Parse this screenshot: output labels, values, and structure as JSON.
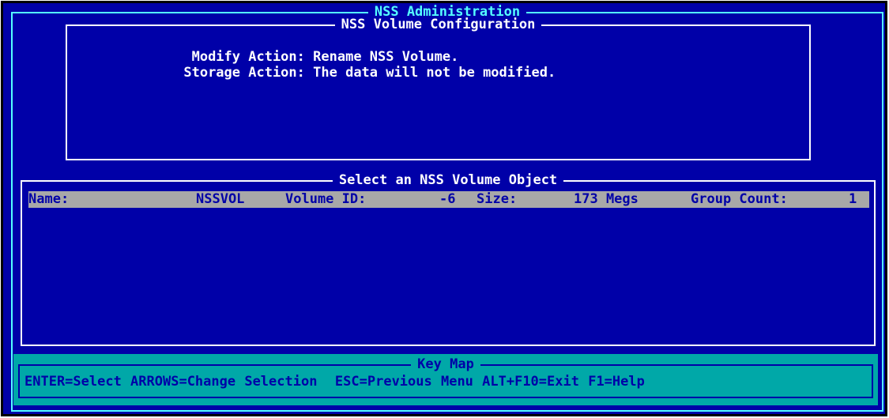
{
  "window": {
    "title": "NSS Administration"
  },
  "config_panel": {
    "title": "NSS Volume Configuration",
    "modify_label": "Modify Action:",
    "modify_value": "Rename NSS Volume.",
    "storage_label": "Storage Action:",
    "storage_value": "The data will not be modified."
  },
  "select_panel": {
    "title": "Select an NSS Volume Object",
    "rows": [
      {
        "name_label": "Name:",
        "name": "NSSVOL",
        "volume_id_label": "Volume ID:",
        "volume_id": "-6",
        "size_label": "Size:",
        "size": "173 Megs",
        "group_count_label": "Group Count:",
        "group_count": "1"
      }
    ]
  },
  "key_map": {
    "title": "Key Map",
    "text": "ENTER=Select ARROWS=Change Selection  ESC=Previous Menu ALT+F10=Exit F1=Help"
  },
  "colors": {
    "background": "#0000a8",
    "frame": "#ffffff",
    "outer_frame": "#55ffff",
    "highlight_row": "#a8a8a8",
    "key_bar": "#00a8a8"
  }
}
